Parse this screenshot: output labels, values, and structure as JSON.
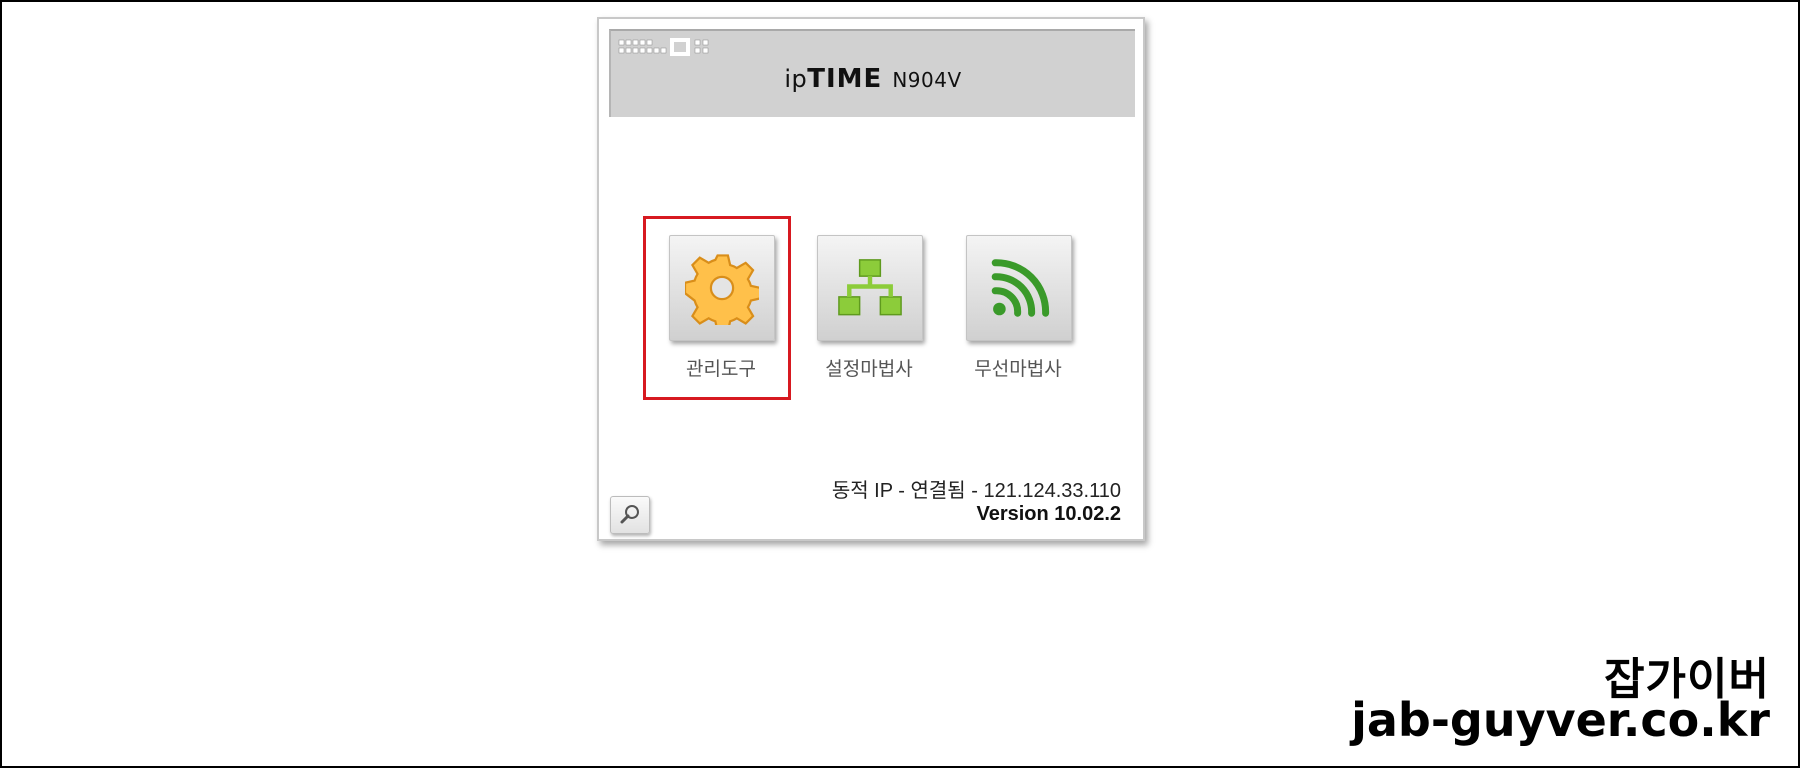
{
  "router": {
    "brand_prefix": "ip",
    "brand_name": "TIME",
    "model": "N904V"
  },
  "menu": [
    {
      "label": "관리도구",
      "icon": "gear-icon",
      "color": "#ffc04a"
    },
    {
      "label": "설정마법사",
      "icon": "network-tree-icon",
      "color": "#8ccc3a"
    },
    {
      "label": "무선마법사",
      "icon": "wifi-icon",
      "color": "#3a9a2a"
    }
  ],
  "status": {
    "connection": "동적 IP - 연결됨 - 121.124.33.110",
    "version": "Version 10.02.2"
  },
  "watermark": {
    "line1": "잡가이버",
    "line2": "jab-guyver.co.kr"
  },
  "colors": {
    "highlight": "#d71920",
    "header_bg": "#d1d1d1"
  }
}
